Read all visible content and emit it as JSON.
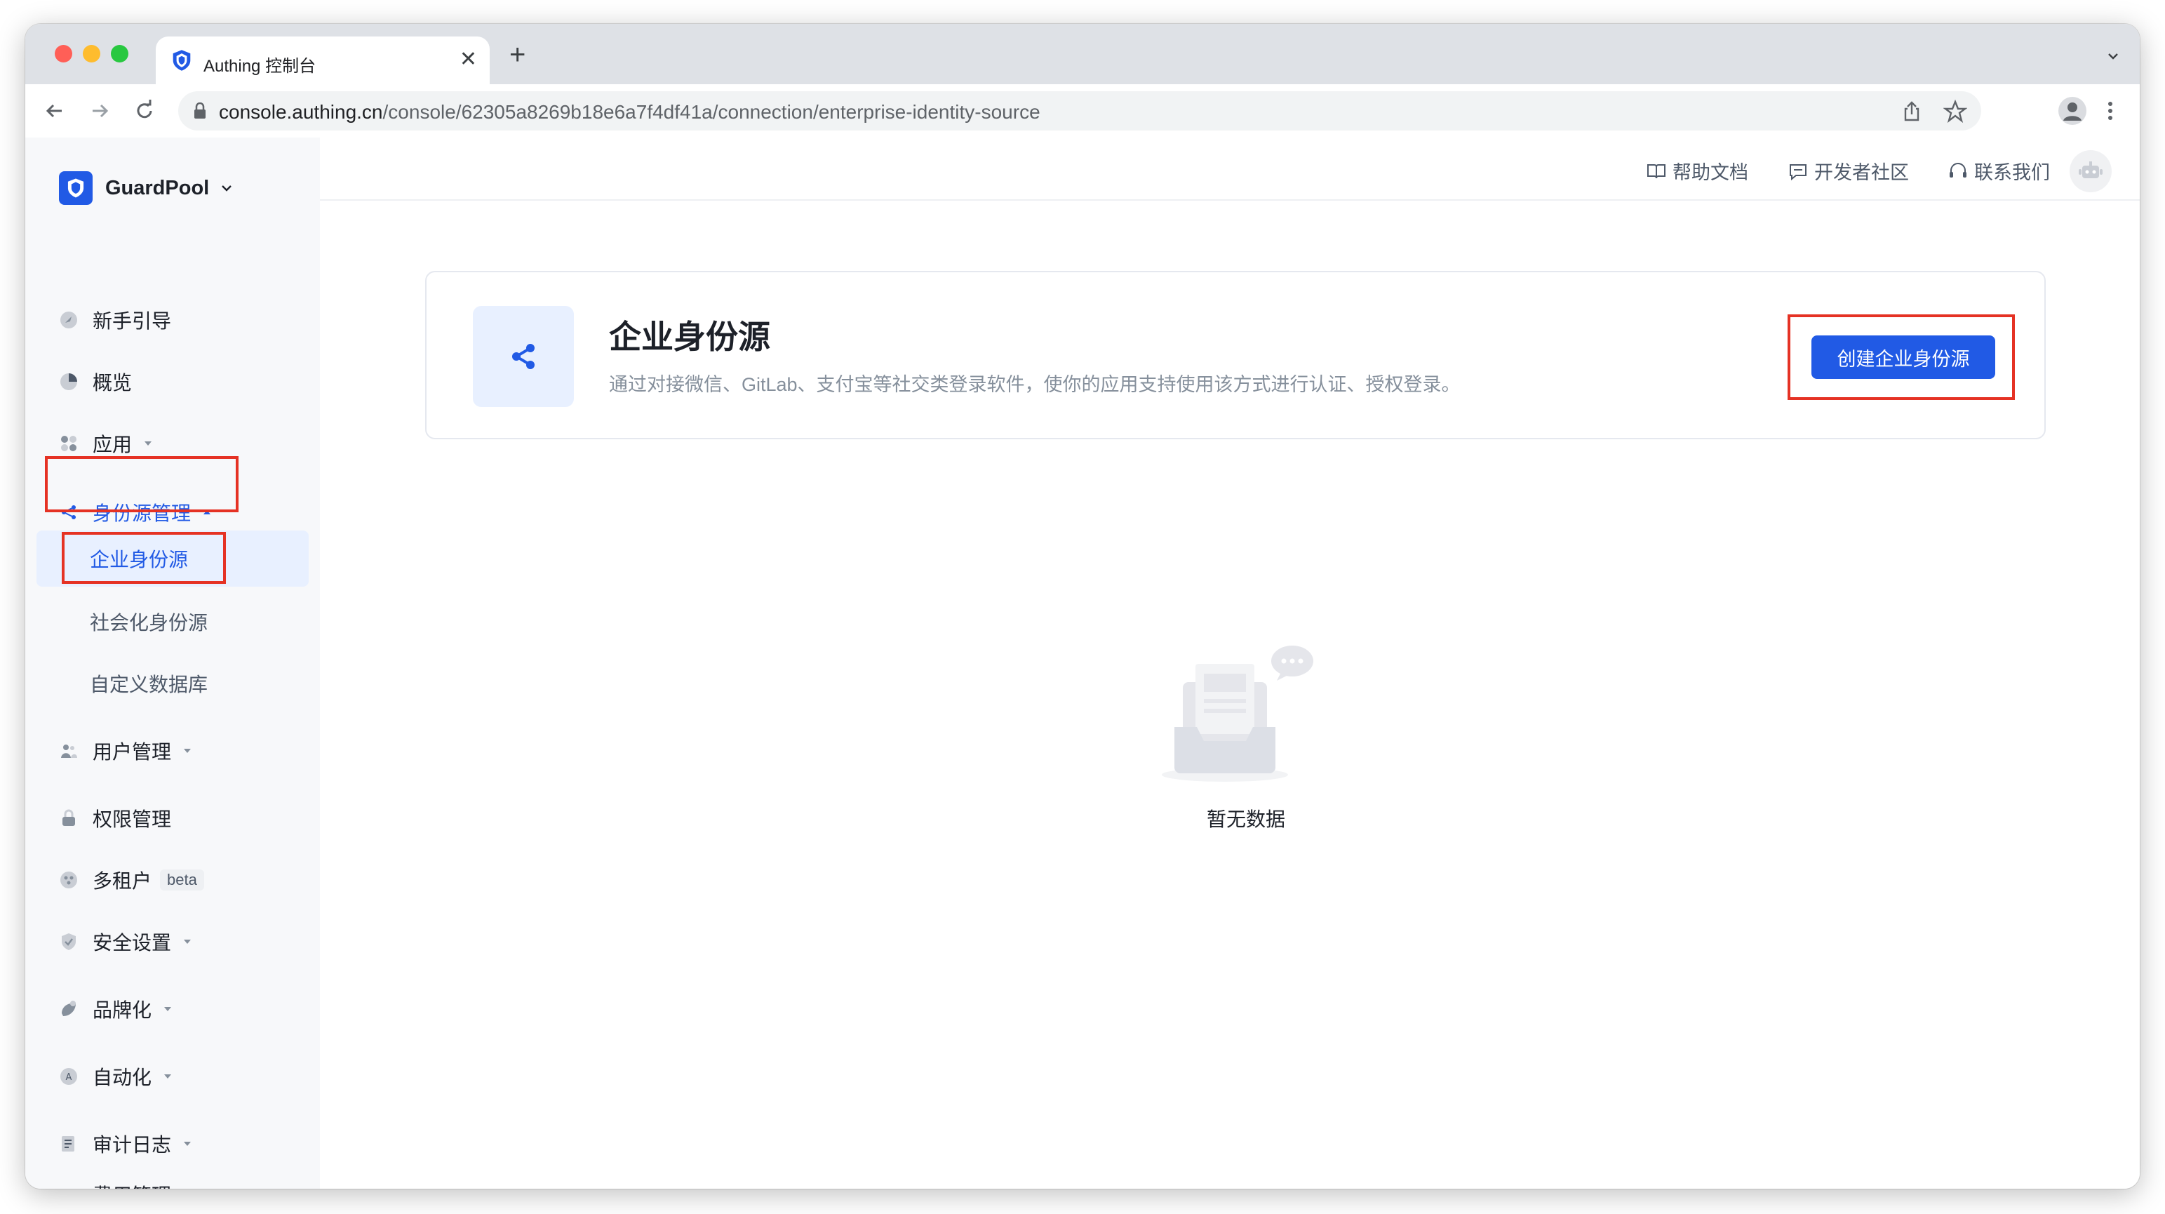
{
  "browser": {
    "tab_title": "Authing 控制台",
    "url_host": "console.authing.cn",
    "url_path": "/console/62305a8269b18e6a7f4df41a/connection/enterprise-identity-source"
  },
  "header": {
    "links": [
      "帮助文档",
      "开发者社区",
      "联系我们"
    ]
  },
  "sidebar": {
    "org_name": "GuardPool",
    "items": [
      {
        "label": "新手引导",
        "icon": "rocket-icon"
      },
      {
        "label": "概览",
        "icon": "pie-chart-icon"
      },
      {
        "label": "应用",
        "icon": "apps-icon"
      },
      {
        "label": "身份源管理",
        "icon": "share-icon"
      },
      {
        "label": "用户管理",
        "icon": "users-icon"
      },
      {
        "label": "权限管理",
        "icon": "lock-icon"
      },
      {
        "label": "多租户",
        "icon": "tenant-icon",
        "badge": "beta"
      },
      {
        "label": "安全设置",
        "icon": "shield-icon"
      },
      {
        "label": "品牌化",
        "icon": "brand-icon"
      },
      {
        "label": "自动化",
        "icon": "automation-icon"
      },
      {
        "label": "审计日志",
        "icon": "log-icon"
      },
      {
        "label": "费用管理",
        "icon": "billing-icon"
      }
    ],
    "sub_items": [
      "企业身份源",
      "社会化身份源",
      "自定义数据库"
    ]
  },
  "main": {
    "title": "企业身份源",
    "description": "通过对接微信、GitLab、支付宝等社交类登录软件，使你的应用支持使用该方式进行认证、授权登录。",
    "create_button": "创建企业身份源",
    "empty_text": "暂无数据"
  },
  "colors": {
    "accent": "#215ae5",
    "highlight": "#e53224"
  }
}
